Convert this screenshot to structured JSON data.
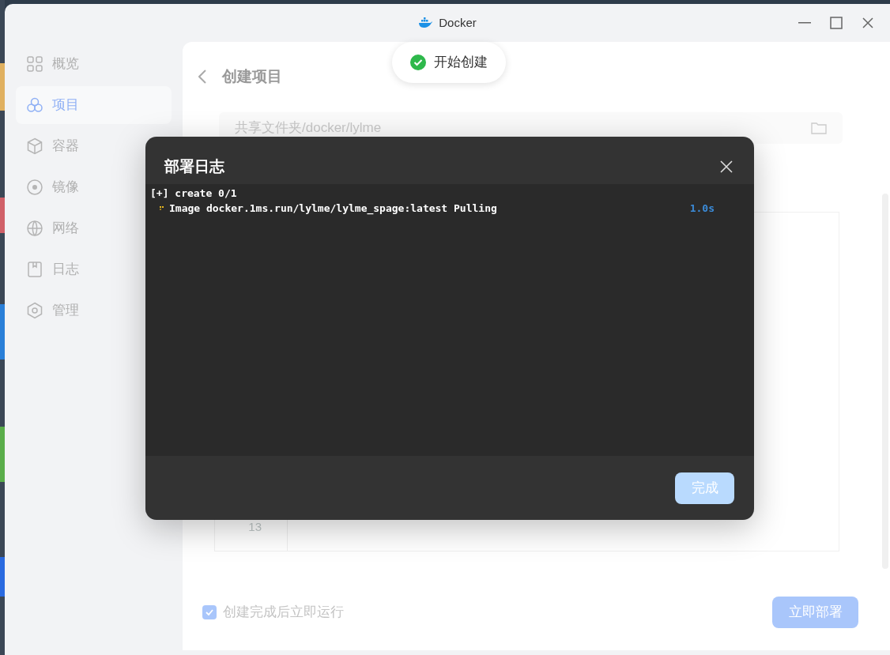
{
  "window": {
    "title": "Docker"
  },
  "sidebar": {
    "items": [
      {
        "label": "概览",
        "selected": false
      },
      {
        "label": "项目",
        "selected": true
      },
      {
        "label": "容器",
        "selected": false
      },
      {
        "label": "镜像",
        "selected": false
      },
      {
        "label": "网络",
        "selected": false
      },
      {
        "label": "日志",
        "selected": false
      },
      {
        "label": "管理",
        "selected": false
      }
    ]
  },
  "page": {
    "title": "创建项目",
    "path_field": {
      "value": "共享文件夹/docker/lylme"
    },
    "editor": {
      "line_number": "13"
    },
    "run_after_create": {
      "label": "创建完成后立即运行",
      "checked": true
    },
    "deploy_button": "立即部署"
  },
  "toast": {
    "text": "开始创建"
  },
  "dialog": {
    "title": "部署日志",
    "log_lines": [
      {
        "kind": "header",
        "text": "[+] create 0/1"
      },
      {
        "kind": "progress",
        "text": "Image docker.1ms.run/lylme/lylme_spage:latest Pulling",
        "time": "1.0s"
      }
    ],
    "done_button": "完成"
  }
}
